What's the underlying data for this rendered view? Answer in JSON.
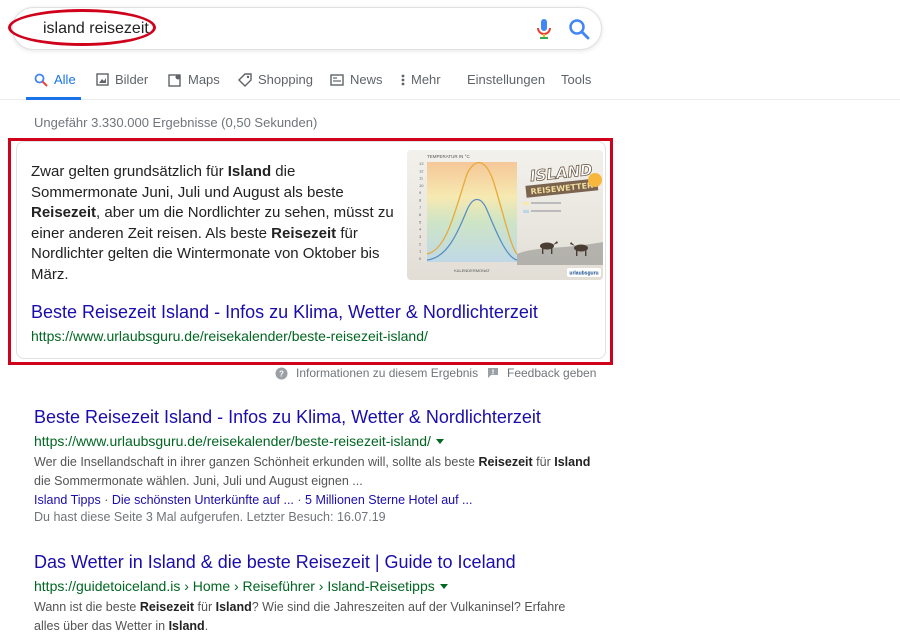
{
  "search": {
    "query": "island reisezeit",
    "mic_icon": "microphone-icon",
    "search_icon": "search-icon"
  },
  "tabs": [
    {
      "label": "Alle",
      "icon": "search-icon",
      "active": true
    },
    {
      "label": "Bilder",
      "icon": "image-icon",
      "active": false
    },
    {
      "label": "Maps",
      "icon": "map-icon",
      "active": false
    },
    {
      "label": "Shopping",
      "icon": "tag-icon",
      "active": false
    },
    {
      "label": "News",
      "icon": "newspaper-icon",
      "active": false
    },
    {
      "label": "Mehr",
      "icon": "more-vert-icon",
      "active": false
    },
    {
      "label": "Einstellungen",
      "active": false
    },
    {
      "label": "Tools",
      "active": false
    }
  ],
  "stats": "Ungefähr 3.330.000 Ergebnisse (0,50 Sekunden)",
  "snippet": {
    "text_parts": [
      {
        "text": "Zwar gelten grundsätzlich für ",
        "bold": false
      },
      {
        "text": "Island",
        "bold": true
      },
      {
        "text": " die Sommermonate Juni, Juli und August als beste ",
        "bold": false
      },
      {
        "text": "Reisezeit",
        "bold": true
      },
      {
        "text": ", aber um die Nordlichter zu sehen, müsst zu einer anderen Zeit reisen. Als beste ",
        "bold": false
      },
      {
        "text": "Reisezeit",
        "bold": true
      },
      {
        "text": " für Nordlichter gelten die Wintermonate von Oktober bis März.",
        "bold": false
      }
    ],
    "image": {
      "chart_title": "TEMPERATUR IN °C",
      "logo_line1": "ISLAND",
      "logo_line2": "REISEWETTER",
      "x_label": "KALENDERMONAT",
      "brand": "urlaubsguru",
      "y_ticks": [
        "13",
        "12",
        "11",
        "10",
        "9",
        "8",
        "7",
        "6",
        "5",
        "4",
        "3",
        "2",
        "1",
        "0"
      ]
    },
    "title": "Beste Reisezeit Island - Infos zu Klima, Wetter & Nordlichterzeit",
    "url": "https://www.urlaubsguru.de/reisekalender/beste-reisezeit-island/"
  },
  "feedback": {
    "info_label": "Informationen zu diesem Ergebnis",
    "feedback_label": "Feedback geben"
  },
  "results": [
    {
      "title": "Beste Reisezeit Island - Infos zu Klima, Wetter & Nordlichterzeit",
      "url": "https://www.urlaubsguru.de/reisekalender/beste-reisezeit-island/",
      "desc_parts": [
        {
          "text": "Wer die Insellandschaft in ihrer ganzen Schönheit erkunden will, sollte als beste ",
          "bold": false
        },
        {
          "text": "Reisezeit",
          "bold": true
        },
        {
          "text": " für ",
          "bold": false
        },
        {
          "text": "Island",
          "bold": true
        },
        {
          "text": " die Sommermonate wählen. Juni, Juli und August eignen ...",
          "bold": false
        }
      ],
      "sitelinks": [
        "Island Tipps",
        "Die schönsten Unterkünfte auf ...",
        "5 Millionen Sterne Hotel auf ..."
      ],
      "visited": "Du hast diese Seite 3 Mal aufgerufen. Letzter Besuch: 16.07.19"
    },
    {
      "title": "Das Wetter in Island & die beste Reisezeit | Guide to Iceland",
      "url": "https://guidetoiceland.is › Home › Reiseführer › Island-Reisetipps",
      "desc_parts": [
        {
          "text": "Wann ist die beste ",
          "bold": false
        },
        {
          "text": "Reisezeit",
          "bold": true
        },
        {
          "text": " für ",
          "bold": false
        },
        {
          "text": "Island",
          "bold": true
        },
        {
          "text": "? Wie sind die Jahreszeiten auf der Vulkaninsel? Erfahre alles über das Wetter in ",
          "bold": false
        },
        {
          "text": "Island",
          "bold": true
        },
        {
          "text": ".",
          "bold": false
        }
      ]
    }
  ],
  "colors": {
    "link": "#1a0dab",
    "url_green": "#006621",
    "accent_blue": "#1a73e8",
    "annotation_red": "#d0021b"
  }
}
